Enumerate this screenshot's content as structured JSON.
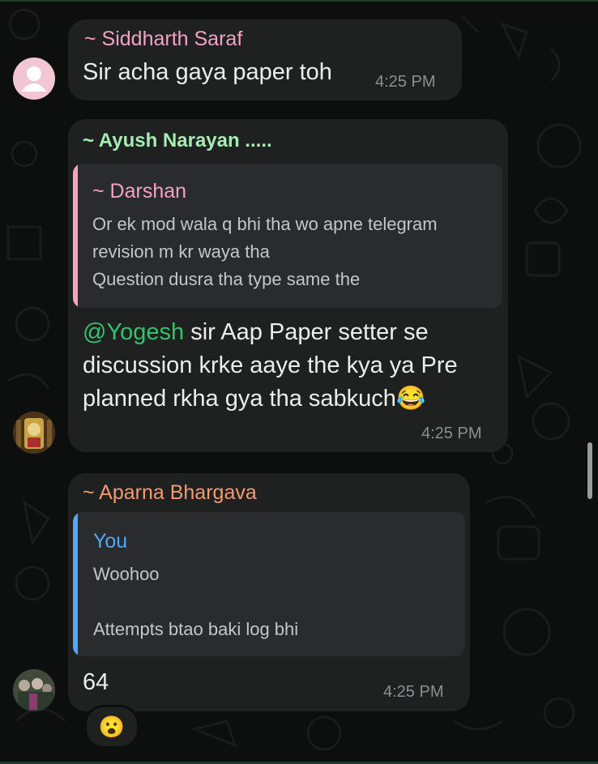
{
  "messages": [
    {
      "sender": "~ Siddharth Saraf",
      "sender_color": "#f5a3c1",
      "text": "Sir acha gaya paper toh",
      "time": "4:25 PM"
    },
    {
      "sender": "~ Ayush Narayan .....",
      "sender_color": "#a6ecb3",
      "quote": {
        "name": "~ Darshan",
        "name_color": "#f5a3c1",
        "bar_color": "#f5a3c1",
        "lines": [
          "Or ek mod wala q bhi tha wo apne telegram",
          "revision m kr waya tha",
          "Question dusra tha type same the"
        ]
      },
      "mention": "@Yogesh",
      "text_lines": [
        " sir Aap Paper setter se",
        "discussion krke aaye the kya ya Pre",
        "planned rkha gya tha sabkuch"
      ],
      "emoji": "😂",
      "time": "4:25 PM"
    },
    {
      "sender": "~ Aparna Bhargava",
      "sender_color": "#f39a73",
      "quote": {
        "name": "You",
        "name_color": "#53a8f5",
        "bar_color": "#53a8f5",
        "lines": [
          "Woohoo",
          "",
          "Attempts btao baki log bhi"
        ]
      },
      "text": "64",
      "time": "4:25 PM",
      "reaction": "😮"
    }
  ],
  "icons": {
    "avatar_1": "default-person-avatar-icon",
    "avatar_2": "shrine-photo-avatar",
    "avatar_3": "group-photo-avatar"
  }
}
